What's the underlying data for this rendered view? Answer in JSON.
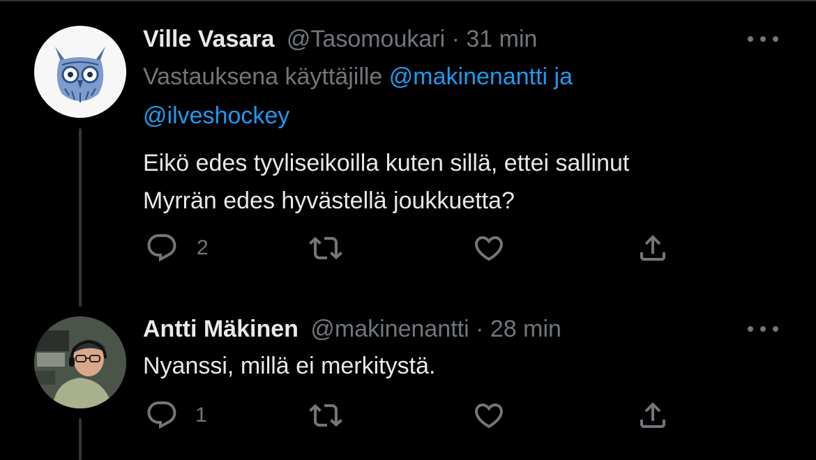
{
  "tweets": [
    {
      "name": "Ville Vasara",
      "handle": "@Tasomoukari",
      "separator": "·",
      "time": "31 min",
      "reply_prefix": "Vastauksena käyttäjille",
      "reply_mention_1": "@makinenantti",
      "reply_conjunction": "ja",
      "reply_mention_2": "@ilveshockey",
      "text_line_1": "Eikö edes tyyliseikoilla kuten sillä, ettei sallinut",
      "text_line_2": "Myrrän edes hyvästellä joukkuetta?",
      "reply_count": "2",
      "retweet_count": "",
      "like_count": ""
    },
    {
      "name": "Antti Mäkinen",
      "handle": "@makinenantti",
      "separator": "·",
      "time": "28 min",
      "text_line_1": "Nyanssi, millä ei merkitystä.",
      "reply_count": "1",
      "retweet_count": "",
      "like_count": ""
    }
  ],
  "icons": {
    "reply": "reply-icon",
    "retweet": "retweet-icon",
    "like": "heart-icon",
    "share": "share-icon",
    "more": "more-icon"
  },
  "colors": {
    "background": "#000000",
    "text": "#e7e9ea",
    "muted": "#71767b",
    "mention": "#1d9bf0",
    "thread_line": "#333639"
  }
}
